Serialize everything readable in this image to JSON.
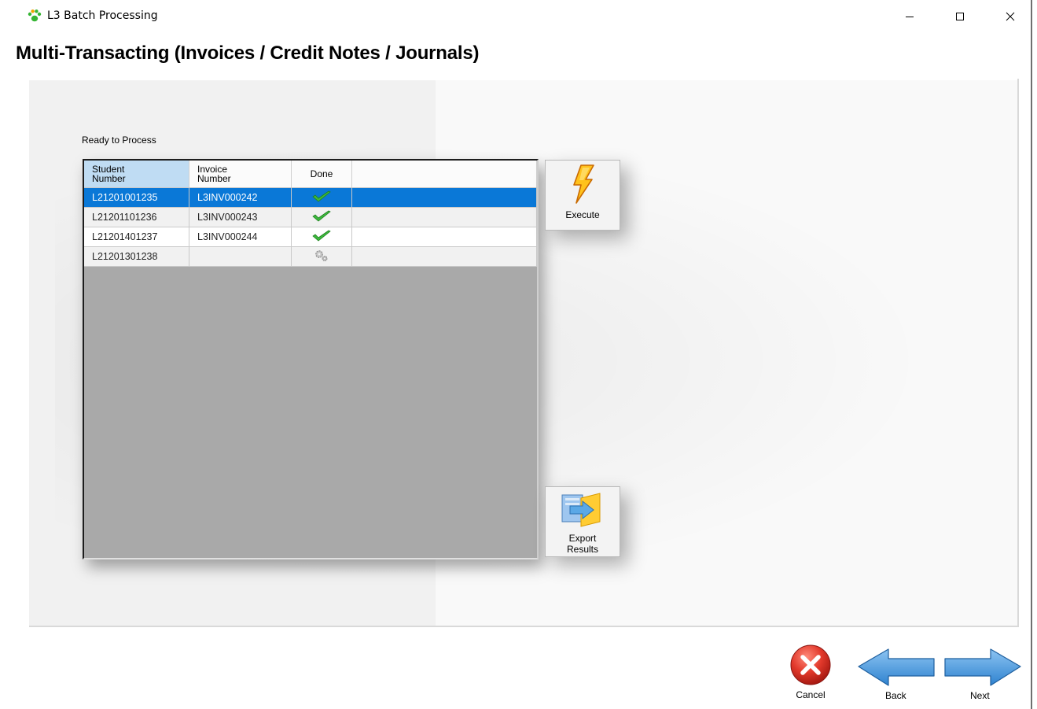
{
  "window": {
    "title": "L3 Batch Processing",
    "controls": [
      "minimize",
      "maximize",
      "close"
    ]
  },
  "page": {
    "title": "Multi-Transacting (Invoices / Credit Notes / Journals)"
  },
  "grid": {
    "label": "Ready to Process",
    "columns": [
      {
        "line1": "Student",
        "line2": "Number"
      },
      {
        "line1": "Invoice",
        "line2": "Number"
      },
      {
        "line1": "Done",
        "line2": ""
      }
    ],
    "rows": [
      {
        "student": "L21201001235",
        "invoice": "L3INV000242",
        "status": "done",
        "selected": true
      },
      {
        "student": "L21201101236",
        "invoice": "L3INV000243",
        "status": "done",
        "selected": false
      },
      {
        "student": "L21201401237",
        "invoice": "L3INV000244",
        "status": "done",
        "selected": false
      },
      {
        "student": "L21201301238",
        "invoice": "",
        "status": "processing",
        "selected": false
      }
    ]
  },
  "buttons": {
    "execute": "Execute",
    "export_line1": "Export",
    "export_line2": "Results",
    "cancel": "Cancel",
    "back": "Back",
    "next": "Next"
  },
  "icons": {
    "app": "paw-icon",
    "execute": "lightning-icon",
    "export": "export-folder-icon",
    "done": "checkmark-icon",
    "processing": "gears-icon",
    "cancel": "cancel-x-icon",
    "back": "left-arrow-icon",
    "next": "right-arrow-icon"
  },
  "colors": {
    "selection": "#0a78d7",
    "header_selected": "#bfdcf3",
    "grid_background": "#a9a9a9",
    "check": "#3cb83c",
    "arrow": "#3d95dd",
    "cancel": "#d8372a"
  }
}
